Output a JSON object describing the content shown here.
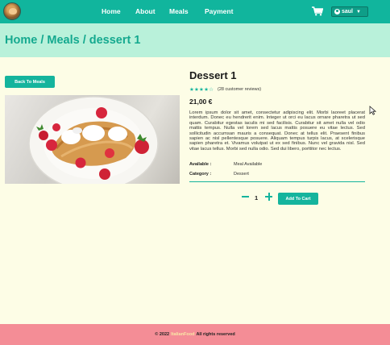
{
  "nav": {
    "links": [
      "Home",
      "About",
      "Meals",
      "Payment"
    ],
    "user": "saul",
    "cart_icon": "cart-icon",
    "user_icon": "user-circle-icon"
  },
  "breadcrumb": "Home  / Meals / dessert 1",
  "back_button": "Back To Meals",
  "product": {
    "title": "Dessert 1",
    "rating": 4,
    "rating_max": 5,
    "stars": "★★★★☆",
    "reviews": "(28 customer reviews)",
    "price": "21,00 €",
    "description": "Lorem ipsum dolor sit amet, consectetur adipiscing elit. Morbi laoreet placerat interdum. Donec eu hendrerit enim. Integer ut orci eu lacus ornare pharetra ut sed quam. Curabitur egestas iaculis mi sed facilisis. Curabitur sit amet nulla vel odio mattis tempus. Nulla vel lorem sed lacus mattis posuere eu vitae lectus. Sed sollicitudin accumsan mauris a consequat. Donec at tellus elit. Praesent finibus sapien ac nisl pellentesque posuere. Aliquam tempus turpis lacus, at scelerisque sapien pharetra et. Vivamus volutpat ut ex sed finibus. Nunc vel gravida nisl. Sed vitae lacus tellus. Morbi sed nulla odio. Sed dui libero, porttitor nec lectus.",
    "available_label": "Available :",
    "available_value": "Meal Available",
    "category_label": "Category :",
    "category_value": "Dessert",
    "quantity": "1",
    "add_to_cart": "Add To Cart"
  },
  "footer": {
    "prefix": "© 2022",
    "brand": "ItalianFood",
    "suffix": "All rights reserved"
  },
  "colors": {
    "accent": "#15b49d",
    "navbar": "#11b59d",
    "breadcrumb_band": "#b9f1da",
    "page_bg": "#fdfde6",
    "footer": "#f48d96"
  }
}
